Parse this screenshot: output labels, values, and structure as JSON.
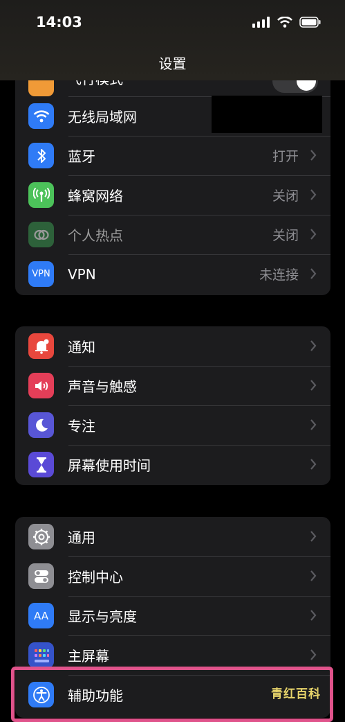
{
  "status": {
    "time": "14:03"
  },
  "nav": {
    "title": "设置"
  },
  "top_partial": {
    "label": "飞行模式"
  },
  "group1": [
    {
      "label": "无线局域网",
      "value": "",
      "icon": "wifi-icon",
      "color": "#2f7bf6"
    },
    {
      "label": "蓝牙",
      "value": "打开",
      "icon": "bluetooth-icon",
      "color": "#2f7bf6"
    },
    {
      "label": "蜂窝网络",
      "value": "关闭",
      "icon": "cellular-icon",
      "color": "#4cc25a"
    },
    {
      "label": "个人热点",
      "value": "关闭",
      "icon": "hotspot-icon",
      "color": "#2e6b3c"
    },
    {
      "label": "VPN",
      "value": "未连接",
      "icon": "vpn-icon",
      "color": "#2f7bf6",
      "badge": "VPN"
    }
  ],
  "group2": [
    {
      "label": "通知",
      "icon": "notification-icon",
      "color": "#e8473d"
    },
    {
      "label": "声音与触感",
      "icon": "speaker-icon",
      "color": "#e43e58"
    },
    {
      "label": "专注",
      "icon": "moon-icon",
      "color": "#5856d6"
    },
    {
      "label": "屏幕使用时间",
      "icon": "hourglass-icon",
      "color": "#5a4ad6"
    }
  ],
  "group3": [
    {
      "label": "通用",
      "icon": "gear-icon",
      "color": "#8e8e93"
    },
    {
      "label": "控制中心",
      "icon": "toggles-icon",
      "color": "#8e8e93"
    },
    {
      "label": "显示与亮度",
      "icon": "text-size-icon",
      "color": "#2f7bf6",
      "badge": "AA"
    },
    {
      "label": "主屏幕",
      "icon": "home-screen-icon",
      "color": "#3553c9"
    },
    {
      "label": "辅助功能",
      "icon": "accessibility-icon",
      "color": "#2f7bf6"
    }
  ],
  "watermark": "青红百科"
}
